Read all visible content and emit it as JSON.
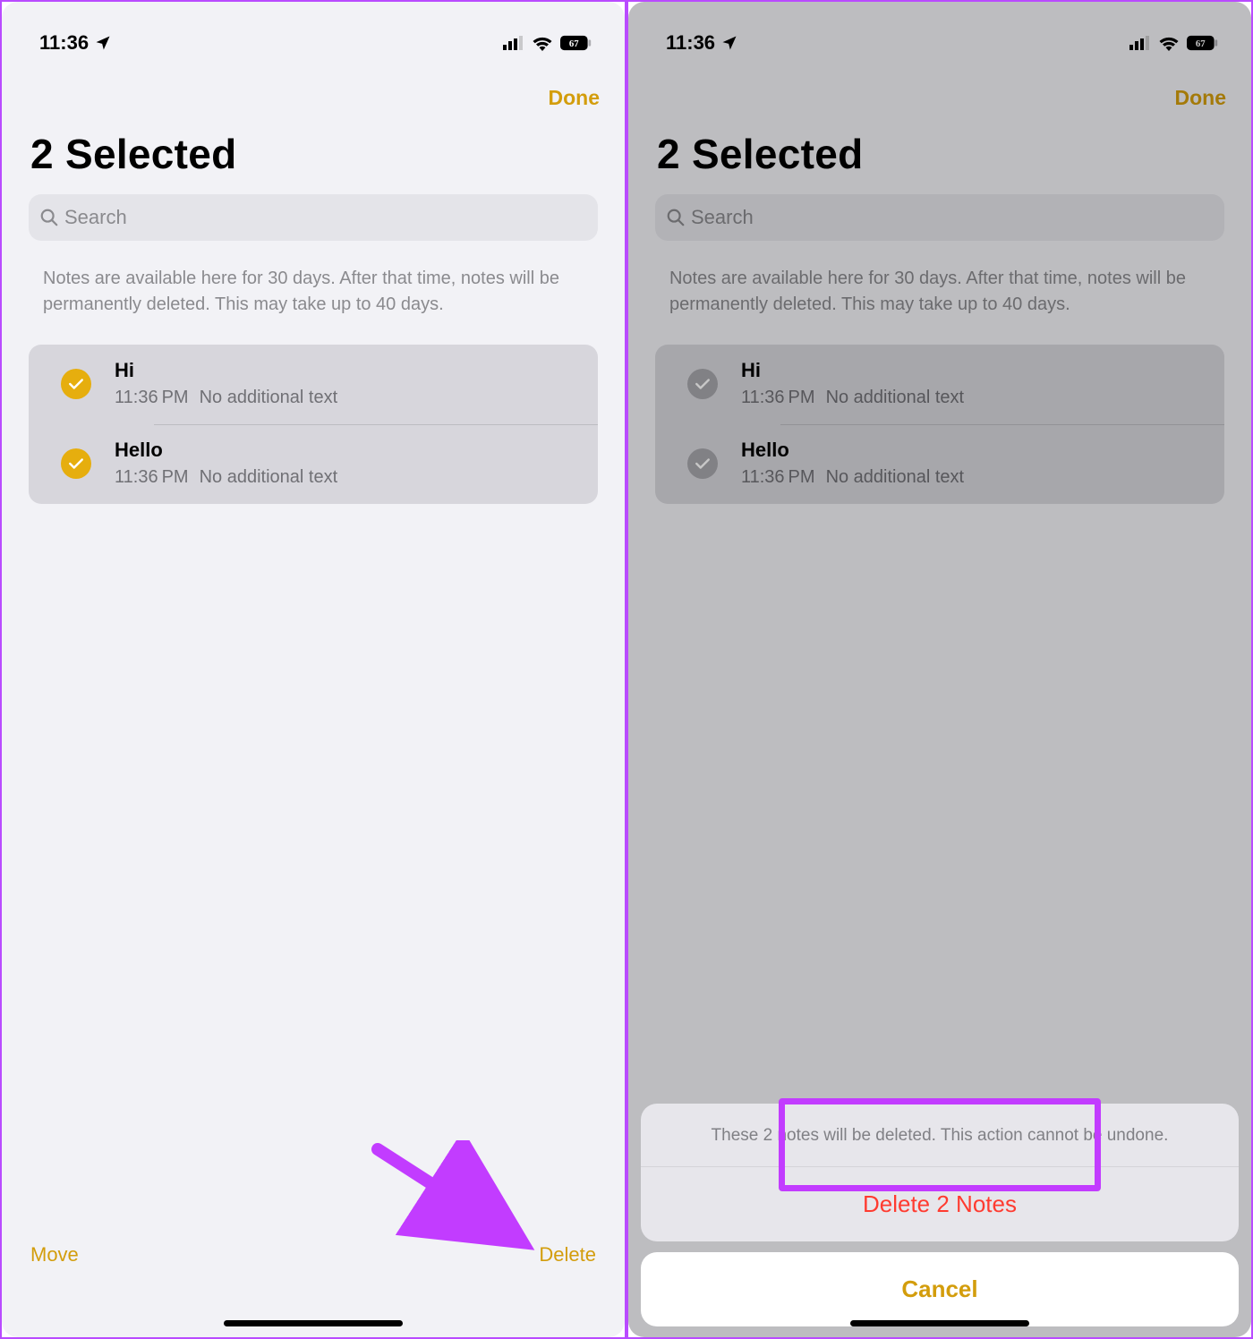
{
  "status": {
    "time": "11:36",
    "battery": "67"
  },
  "header": {
    "done_label": "Done",
    "title": "2 Selected"
  },
  "search": {
    "placeholder": "Search"
  },
  "info_text": "Notes are available here for 30 days. After that time, notes will be permanently deleted. This may take up to 40 days.",
  "notes": [
    {
      "title": "Hi",
      "time": "11:36 PM",
      "subtitle": "No additional text"
    },
    {
      "title": "Hello",
      "time": "11:36 PM",
      "subtitle": "No additional text"
    }
  ],
  "toolbar": {
    "move_label": "Move",
    "delete_label": "Delete"
  },
  "sheet": {
    "message": "These 2 notes will be deleted. This action cannot be undone.",
    "destructive_label": "Delete 2 Notes",
    "cancel_label": "Cancel"
  }
}
